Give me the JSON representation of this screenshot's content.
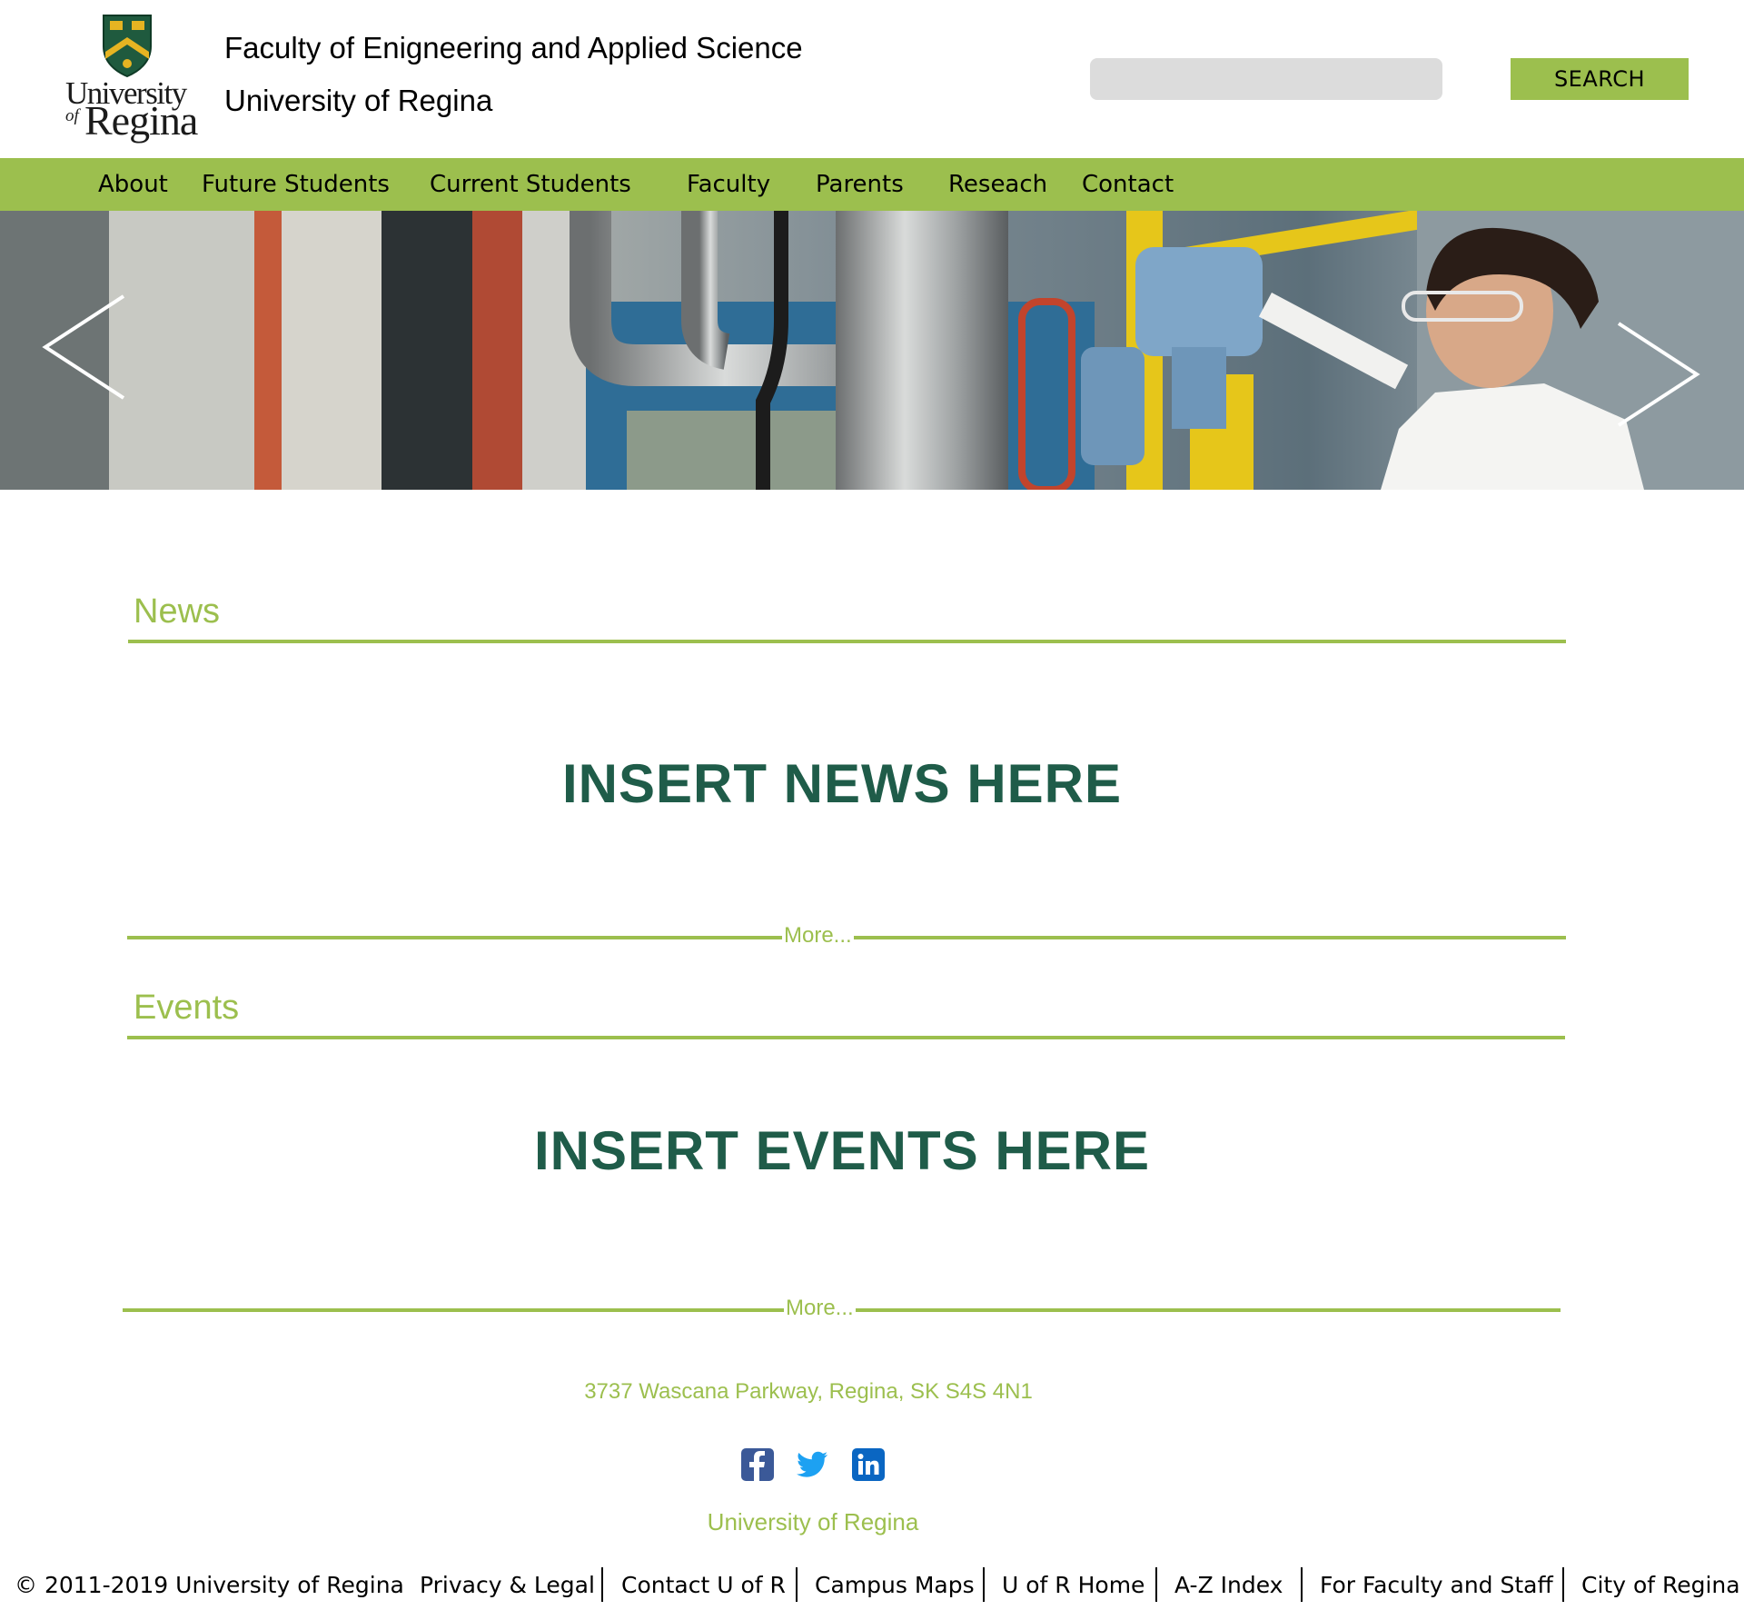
{
  "header": {
    "logo": {
      "line1": "University",
      "line2": "of",
      "line3": "Regina"
    },
    "faculty_title": "Faculty of Enigneering and Applied Science",
    "university_title": "University of Regina",
    "search": {
      "placeholder": "",
      "value": "",
      "button_label": "SEARCH"
    }
  },
  "nav": {
    "items": [
      {
        "label": "About"
      },
      {
        "label": "Future Students"
      },
      {
        "label": "Current Students"
      },
      {
        "label": "Faculty"
      },
      {
        "label": "Parents"
      },
      {
        "label": "Reseach"
      },
      {
        "label": "Contact"
      }
    ]
  },
  "hero": {
    "prev_icon": "chevron-left-icon",
    "next_icon": "chevron-right-icon"
  },
  "news": {
    "title": "News",
    "placeholder": "INSERT NEWS HERE",
    "more": "More..."
  },
  "events": {
    "title": "Events",
    "placeholder": "INSERT EVENTS HERE",
    "more": "More..."
  },
  "footer": {
    "address": "3737 Wascana Parkway, Regina, SK S4S 4N1",
    "social": [
      "facebook-icon",
      "twitter-icon",
      "linkedin-icon"
    ],
    "university": "University of Regina",
    "copyright": "© 2011-2019 University of Regina",
    "links": [
      {
        "label": "Privacy & Legal"
      },
      {
        "label": "Contact U of R"
      },
      {
        "label": "Campus Maps"
      },
      {
        "label": "U of R Home"
      },
      {
        "label": "A-Z Index"
      },
      {
        "label": "For Faculty and Staff"
      },
      {
        "label": "City of Regina"
      }
    ]
  },
  "colors": {
    "accent_green": "#9cbf4e",
    "dark_green": "#1f5c49",
    "search_bg": "#dcdcdc"
  }
}
